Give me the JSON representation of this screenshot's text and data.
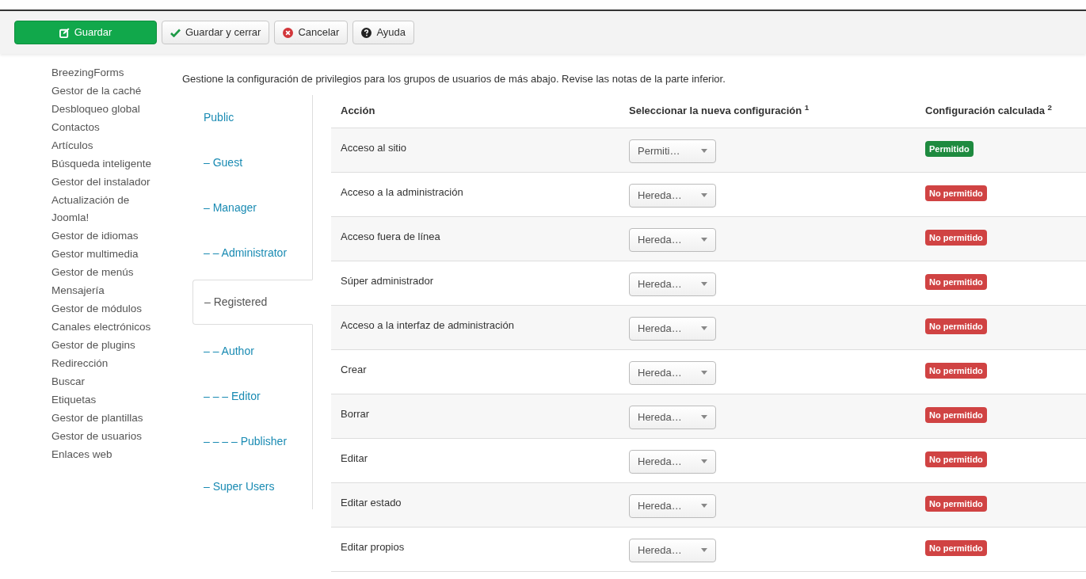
{
  "toolbar": {
    "buttons": [
      {
        "label": "Guardar",
        "kind": "save"
      },
      {
        "label": "Guardar y cerrar",
        "kind": "save-close"
      },
      {
        "label": "Cancelar",
        "kind": "cancel"
      },
      {
        "label": "Ayuda",
        "kind": "help"
      }
    ]
  },
  "sidebar": {
    "items": [
      "BreezingForms",
      "Gestor de la caché",
      "Desbloqueo global",
      "Contactos",
      "Artículos",
      "Búsqueda inteligente",
      "Gestor del instalador",
      "Actualización de Joomla!",
      "Gestor de idiomas",
      "Gestor multimedia",
      "Gestor de menús",
      "Mensajería",
      "Gestor de módulos",
      "Canales electrónicos",
      "Gestor de plugins",
      "Redirección",
      "Buscar",
      "Etiquetas",
      "Gestor de plantillas",
      "Gestor de usuarios",
      "Enlaces web"
    ]
  },
  "description": "Gestione la configuración de privilegios para los grupos de usuarios de más abajo. Revise las notas de la parte inferior.",
  "groups": [
    {
      "label": "Public",
      "selected": false
    },
    {
      "label": "– Guest",
      "selected": false
    },
    {
      "label": "– Manager",
      "selected": false
    },
    {
      "label": "– – Administrator",
      "selected": false
    },
    {
      "label": "– Registered",
      "selected": true
    },
    {
      "label": "– – Author",
      "selected": false
    },
    {
      "label": "– – – Editor",
      "selected": false
    },
    {
      "label": "– – – – Publisher",
      "selected": false
    },
    {
      "label": "– Super Users",
      "selected": false
    }
  ],
  "table": {
    "columns": [
      "Acción",
      "Seleccionar la nueva configuración $^{1}$",
      "Configuración calculada $^{2}$"
    ],
    "rows": [
      {
        "action": "Acceso al sitio",
        "setting": "Permiti…",
        "result": "Permitido",
        "kind": "allowed"
      },
      {
        "action": "Acceso a la administración",
        "setting": "Hereda…",
        "result": "No permitido",
        "kind": "denied"
      },
      {
        "action": "Acceso fuera de línea",
        "setting": "Hereda…",
        "result": "No permitido",
        "kind": "denied"
      },
      {
        "action": "Súper administrador",
        "setting": "Hereda…",
        "result": "No permitido",
        "kind": "denied"
      },
      {
        "action": "Acceso a la interfaz de administración",
        "setting": "Hereda…",
        "result": "No permitido",
        "kind": "denied"
      },
      {
        "action": "Crear",
        "setting": "Hereda…",
        "result": "No permitido",
        "kind": "denied"
      },
      {
        "action": "Borrar",
        "setting": "Hereda…",
        "result": "No permitido",
        "kind": "denied"
      },
      {
        "action": "Editar",
        "setting": "Hereda…",
        "result": "No permitido",
        "kind": "denied"
      },
      {
        "action": "Editar estado",
        "setting": "Hereda…",
        "result": "No permitido",
        "kind": "denied"
      },
      {
        "action": "Editar propios",
        "setting": "Hereda…",
        "result": "No permitido",
        "kind": "denied"
      }
    ]
  }
}
